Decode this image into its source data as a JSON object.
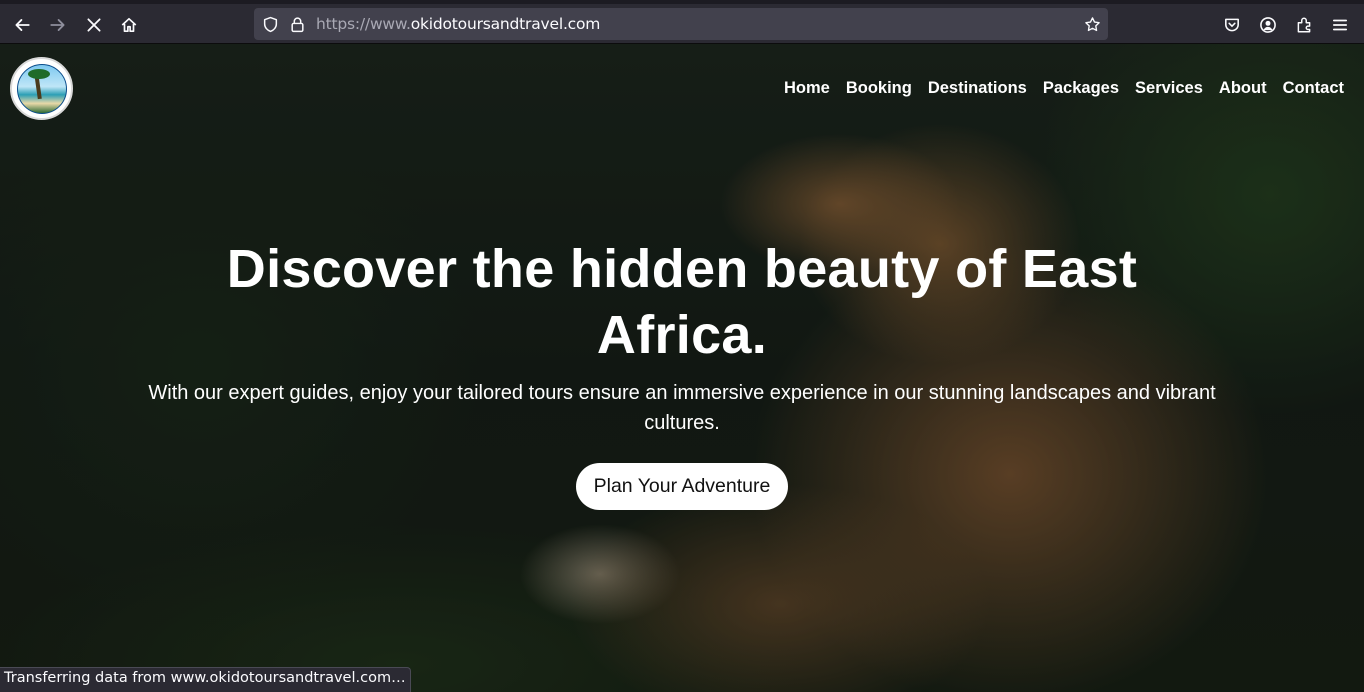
{
  "browser": {
    "url_prefix": "https://www.",
    "url_domain": "okidotoursandtravel.com",
    "status_text": "Transferring data from www.okidotoursandtravel.com…",
    "icons": [
      "back-icon",
      "forward-icon",
      "stop-icon",
      "home-icon",
      "shield-icon",
      "lock-icon",
      "star-icon",
      "pocket-icon",
      "account-icon",
      "extensions-icon",
      "menu-icon"
    ]
  },
  "site": {
    "nav": [
      {
        "label": "Home"
      },
      {
        "label": "Booking"
      },
      {
        "label": "Destinations"
      },
      {
        "label": "Packages"
      },
      {
        "label": "Services"
      },
      {
        "label": "About"
      },
      {
        "label": "Contact"
      }
    ],
    "hero": {
      "title": "Discover the hidden beauty of East Africa.",
      "subtitle": "With our expert guides, enjoy your tailored tours ensure an immersive experience in our stunning landscapes and vibrant cultures.",
      "cta_label": "Plan Your Adventure"
    }
  },
  "colors": {
    "toolbar_bg": "#2b2a33",
    "urlbar_bg": "#42414d",
    "cta_bg": "#ffffff",
    "text": "#ffffff"
  }
}
